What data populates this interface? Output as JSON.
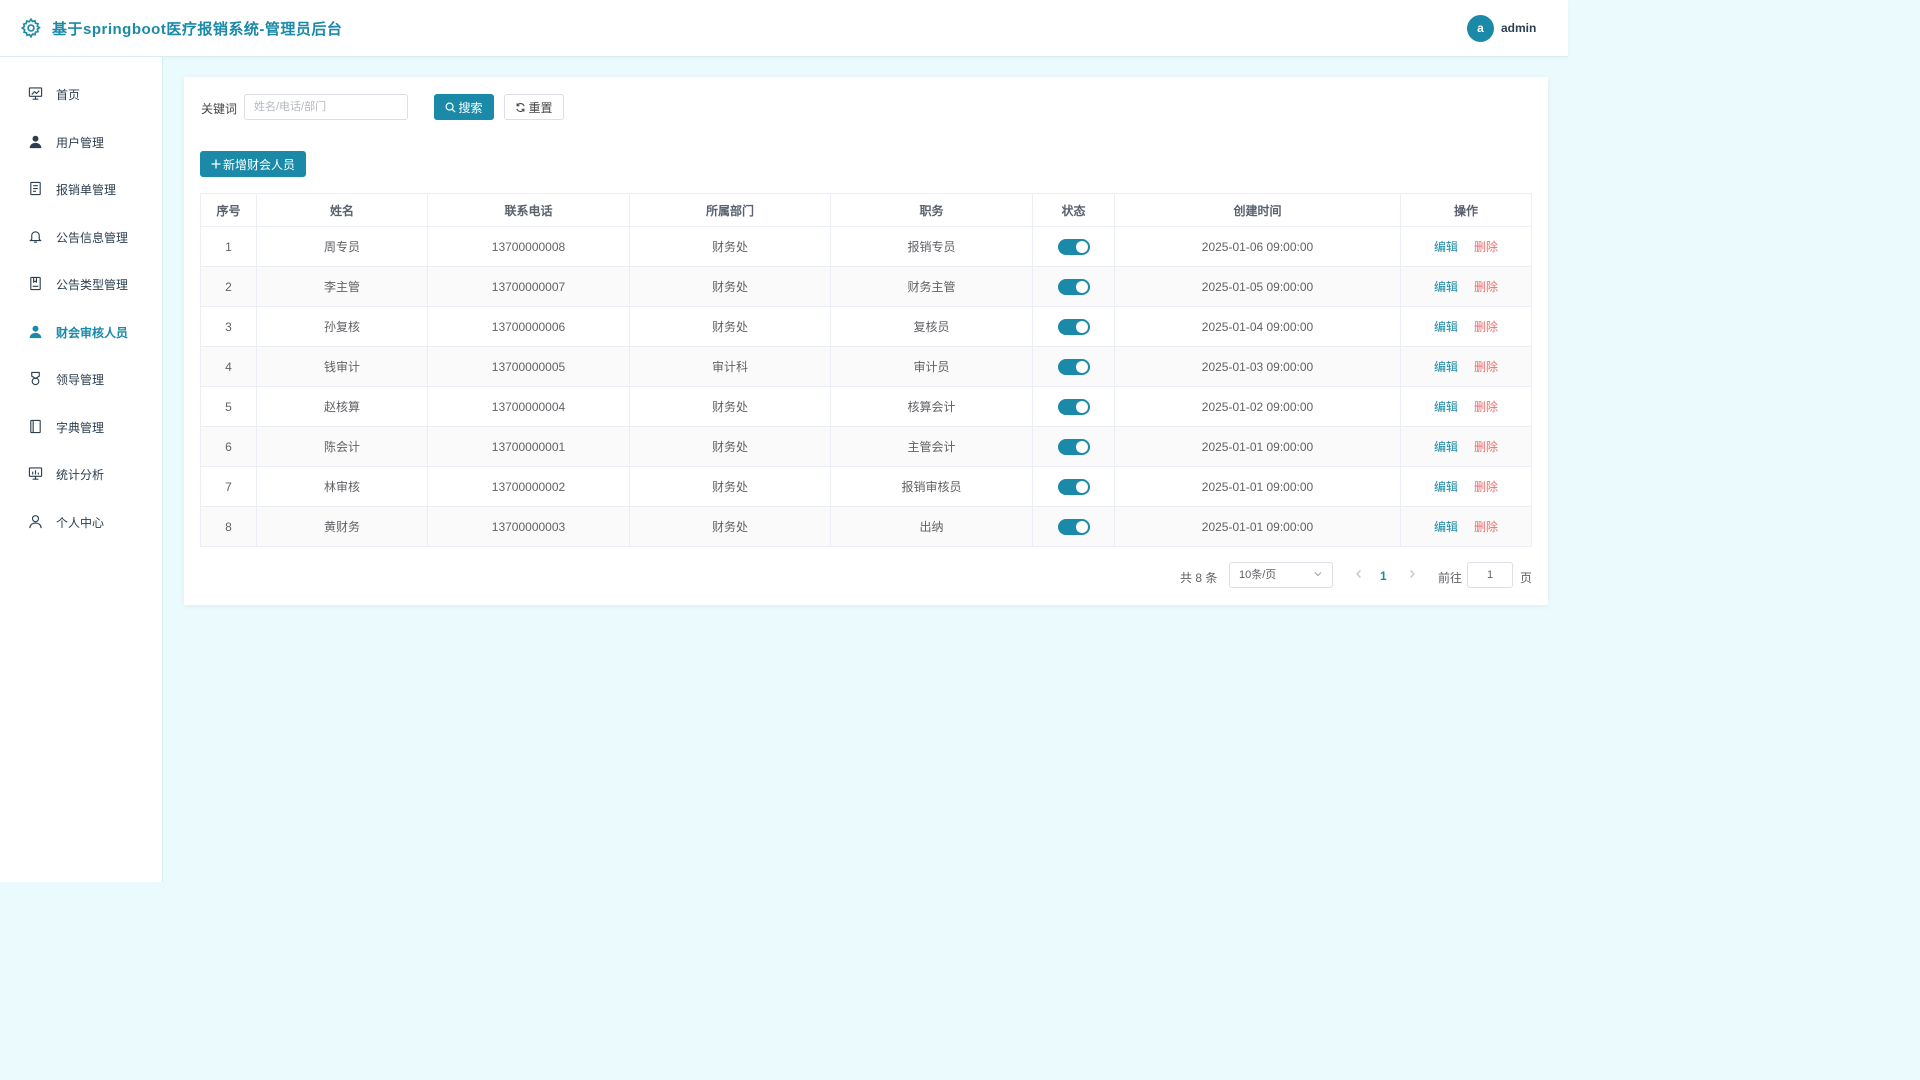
{
  "app": {
    "title": "基于springboot医疗报销系统-管理员后台"
  },
  "user": {
    "avatar_letter": "a",
    "name": "admin"
  },
  "colors": {
    "primary": "#1a8aa8",
    "danger": "#f56c6c",
    "page_bg": "#ebfbfd"
  },
  "sidebar": {
    "items": [
      {
        "label": "首页",
        "icon": "dashboard-icon"
      },
      {
        "label": "用户管理",
        "icon": "user-icon"
      },
      {
        "label": "报销单管理",
        "icon": "document-icon"
      },
      {
        "label": "公告信息管理",
        "icon": "bell-icon"
      },
      {
        "label": "公告类型管理",
        "icon": "notebook-icon"
      },
      {
        "label": "财会审核人员",
        "icon": "user-icon",
        "active": true
      },
      {
        "label": "领导管理",
        "icon": "medal-icon"
      },
      {
        "label": "字典管理",
        "icon": "book-icon"
      },
      {
        "label": "统计分析",
        "icon": "chart-icon"
      },
      {
        "label": "个人中心",
        "icon": "user-outline-icon"
      }
    ]
  },
  "search": {
    "label": "关键词",
    "placeholder": "姓名/电话/部门",
    "value": "",
    "search_button": "搜索",
    "reset_button": "重置"
  },
  "add_button": "新增财会人员",
  "table": {
    "headers": [
      "序号",
      "姓名",
      "联系电话",
      "所属部门",
      "职务",
      "状态",
      "创建时间",
      "操作"
    ],
    "edit_label": "编辑",
    "delete_label": "删除",
    "rows": [
      {
        "index": "1",
        "name": "周专员",
        "phone": "13700000008",
        "dept": "财务处",
        "position": "报销专员",
        "enabled": true,
        "created": "2025-01-06 09:00:00"
      },
      {
        "index": "2",
        "name": "李主管",
        "phone": "13700000007",
        "dept": "财务处",
        "position": "财务主管",
        "enabled": true,
        "created": "2025-01-05 09:00:00"
      },
      {
        "index": "3",
        "name": "孙复核",
        "phone": "13700000006",
        "dept": "财务处",
        "position": "复核员",
        "enabled": true,
        "created": "2025-01-04 09:00:00"
      },
      {
        "index": "4",
        "name": "钱审计",
        "phone": "13700000005",
        "dept": "审计科",
        "position": "审计员",
        "enabled": true,
        "created": "2025-01-03 09:00:00"
      },
      {
        "index": "5",
        "name": "赵核算",
        "phone": "13700000004",
        "dept": "财务处",
        "position": "核算会计",
        "enabled": true,
        "created": "2025-01-02 09:00:00"
      },
      {
        "index": "6",
        "name": "陈会计",
        "phone": "13700000001",
        "dept": "财务处",
        "position": "主管会计",
        "enabled": true,
        "created": "2025-01-01 09:00:00"
      },
      {
        "index": "7",
        "name": "林审核",
        "phone": "13700000002",
        "dept": "财务处",
        "position": "报销审核员",
        "enabled": true,
        "created": "2025-01-01 09:00:00"
      },
      {
        "index": "8",
        "name": "黄财务",
        "phone": "13700000003",
        "dept": "财务处",
        "position": "出纳",
        "enabled": true,
        "created": "2025-01-01 09:00:00"
      }
    ]
  },
  "pagination": {
    "total_text": "共 8 条",
    "page_size": "10条/页",
    "current_page": "1",
    "goto_label": "前往",
    "goto_value": "1",
    "goto_suffix": "页"
  }
}
